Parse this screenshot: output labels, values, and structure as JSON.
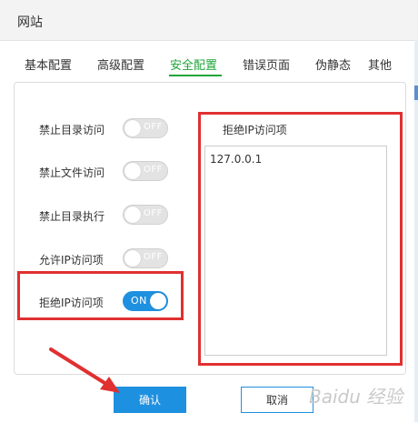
{
  "window": {
    "title": "网站"
  },
  "tabs": [
    "基本配置",
    "高级配置",
    "安全配置",
    "错误页面",
    "伪静态",
    "其他"
  ],
  "active_tab": "安全配置",
  "settings": [
    {
      "label": "禁止目录访问",
      "state": "OFF"
    },
    {
      "label": "禁止文件访问",
      "state": "OFF"
    },
    {
      "label": "禁止目录执行",
      "state": "OFF"
    },
    {
      "label": "允许IP访问项",
      "state": "OFF"
    },
    {
      "label": "拒绝IP访问项",
      "state": "ON"
    }
  ],
  "deny_ip": {
    "label": "拒绝IP访问项",
    "value": "127.0.0.1"
  },
  "buttons": {
    "confirm": "确认",
    "cancel": "取消"
  },
  "watermark": "Baidu 经验",
  "colors": {
    "accent": "#1e90e0",
    "active_tab": "#20a53a",
    "highlight": "#e03030",
    "switch_off": "#e3e3e3"
  }
}
